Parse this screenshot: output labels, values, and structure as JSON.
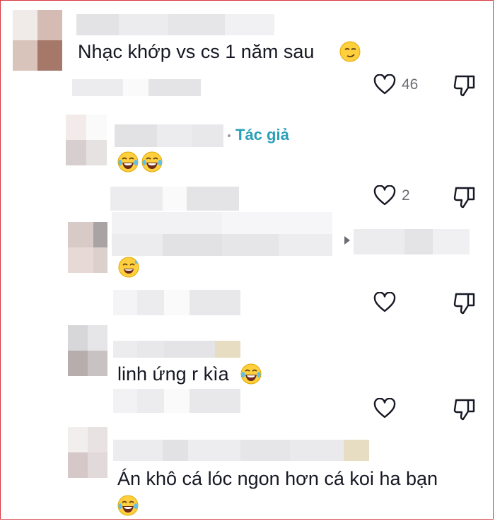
{
  "comments": [
    {
      "id": "c1",
      "text": "Nhạc khớp vs cs 1 năm sau",
      "emoji": "smirk-emoji",
      "likes": "46"
    },
    {
      "id": "c2",
      "author_tag": "Tác giả",
      "text": "",
      "emoji": "laughing-tears-emoji",
      "likes": "2"
    },
    {
      "id": "c3",
      "text": "",
      "emoji": "sweat-smile-emoji",
      "likes": ""
    },
    {
      "id": "c4",
      "text": "linh ứng r kìa",
      "emoji": "laughing-tears-emoji",
      "likes": ""
    },
    {
      "id": "c5",
      "text": "Án khô cá lóc ngon hơn cá koi ha bạn",
      "emoji": "laughing-tears-emoji",
      "likes": ""
    }
  ],
  "icons": {
    "like": "heart-outline-icon",
    "dislike": "thumbs-down-icon",
    "expand": "triangle-right-icon"
  },
  "colors": {
    "author_tag": "#2a9fb8",
    "frame_border": "#d9363e",
    "text": "#161823",
    "muted": "#6c6c74"
  }
}
